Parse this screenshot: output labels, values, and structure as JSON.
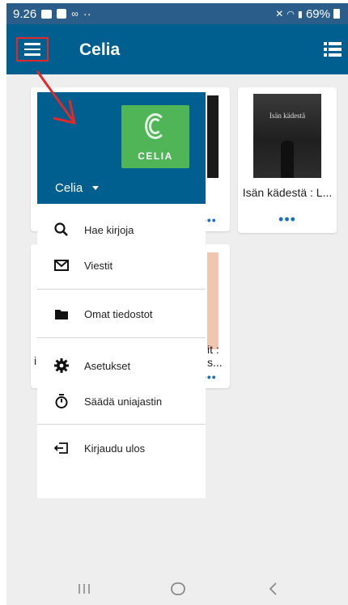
{
  "status_bar": {
    "time": "9.26",
    "battery": "69%",
    "overflow": "··"
  },
  "app_bar": {
    "title": "Celia"
  },
  "books": [
    {
      "title": "Isän kädestä : L...",
      "cover_title": "Isän kädestä"
    }
  ],
  "partial_text": {
    "card1": "i",
    "card2": "it :",
    "card2_line2": "s..."
  },
  "drawer": {
    "logo_text": "CELIA",
    "account_name": "Celia",
    "items": [
      {
        "label": "Hae kirjoja",
        "icon": "search-icon"
      },
      {
        "label": "Viestit",
        "icon": "mail-icon"
      },
      {
        "label": "Omat tiedostot",
        "icon": "folder-icon"
      },
      {
        "label": "Asetukset",
        "icon": "gear-icon"
      },
      {
        "label": "Säädä uniajastin",
        "icon": "timer-icon"
      },
      {
        "label": "Kirjaudu ulos",
        "icon": "logout-icon"
      }
    ]
  },
  "colors": {
    "app_bar": "#005f8f",
    "status_bar": "#2a5d89",
    "logo_green": "#4fb556",
    "highlight_red": "#e02a2a",
    "accent": "#1d6fb8"
  }
}
